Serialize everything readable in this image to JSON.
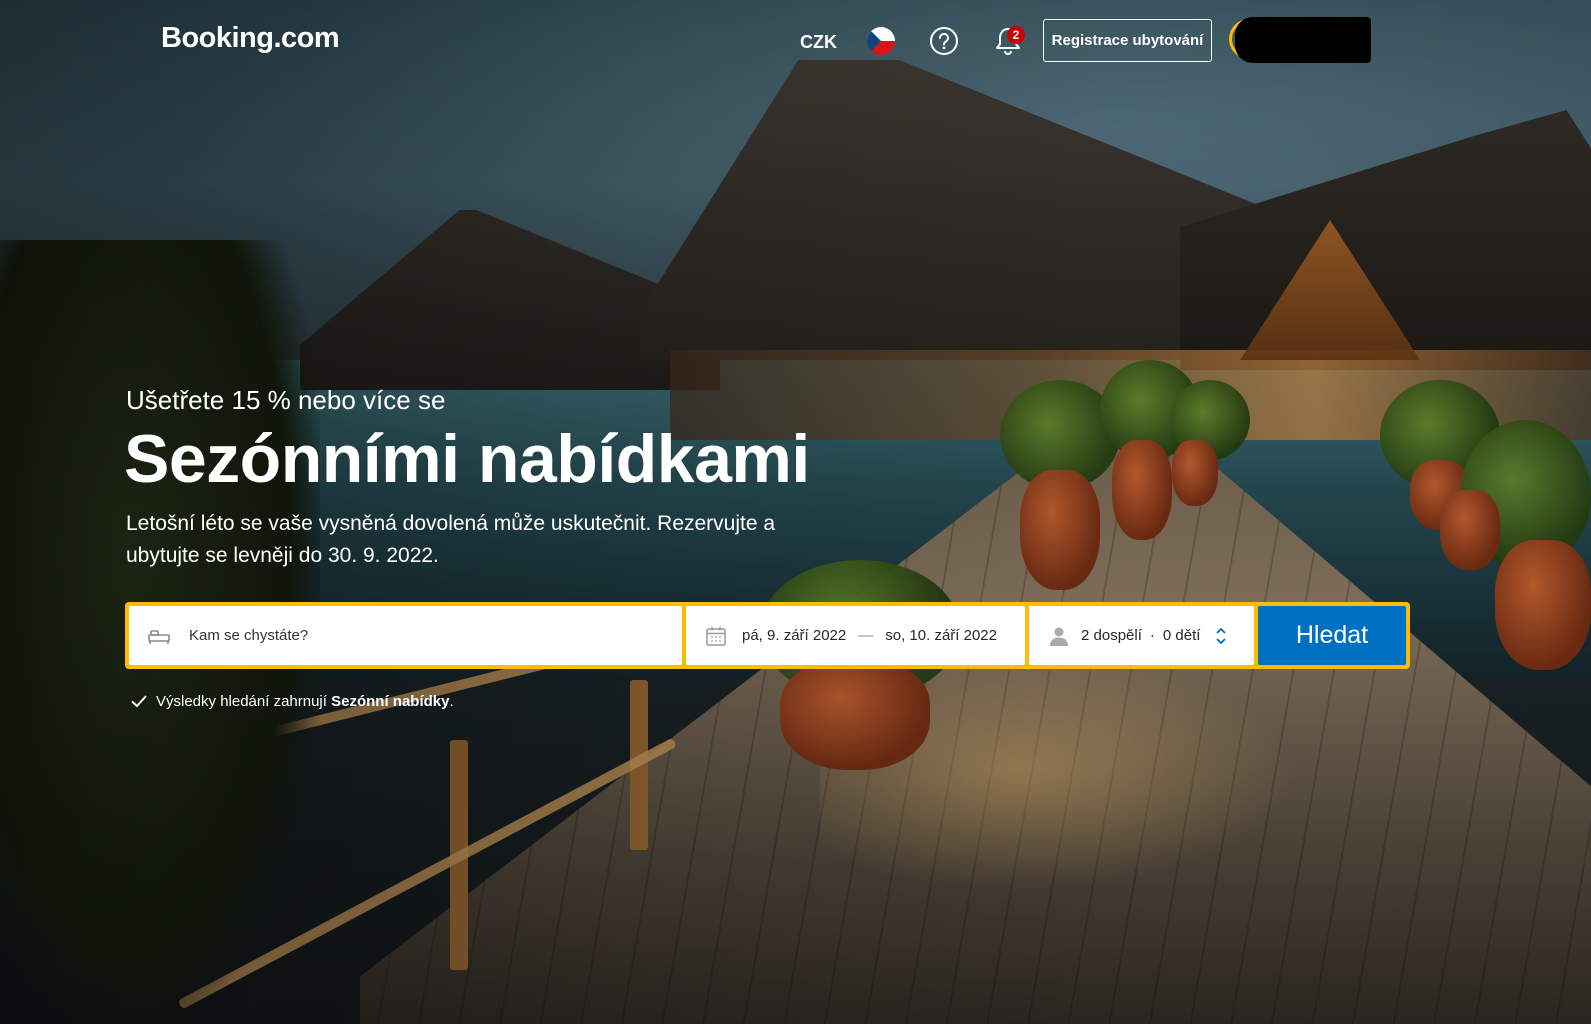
{
  "header": {
    "logo": "Booking.com",
    "currency": "CZK",
    "notification_count": "2",
    "register_label": "Registrace ubytování",
    "icons": [
      "cz-flag-icon",
      "help-icon",
      "bell-icon"
    ]
  },
  "hero": {
    "kicker": "Ušetřete 15 % nebo více se",
    "headline": "Sezónními nabídkami",
    "subtitle": "Letošní léto se vaše vysněná dovolená může uskutečnit. Rezervujte a ubytujte se levněji do 30. 9. 2022."
  },
  "search": {
    "destination_placeholder": "Kam se chystáte?",
    "checkin": "pá, 9. září 2022",
    "separator": "—",
    "checkout": "so, 10. září 2022",
    "adults": "2 dospělí",
    "dot": "·",
    "children": "0 dětí",
    "button": "Hledat"
  },
  "note": {
    "prefix": "Výsledky hledání zahrnují",
    "emphasis": "Sezónní nabídky",
    "suffix": "."
  },
  "colors": {
    "accent_yellow": "#febb02",
    "button_blue": "#0071c2",
    "badge_red": "#cc0000"
  }
}
